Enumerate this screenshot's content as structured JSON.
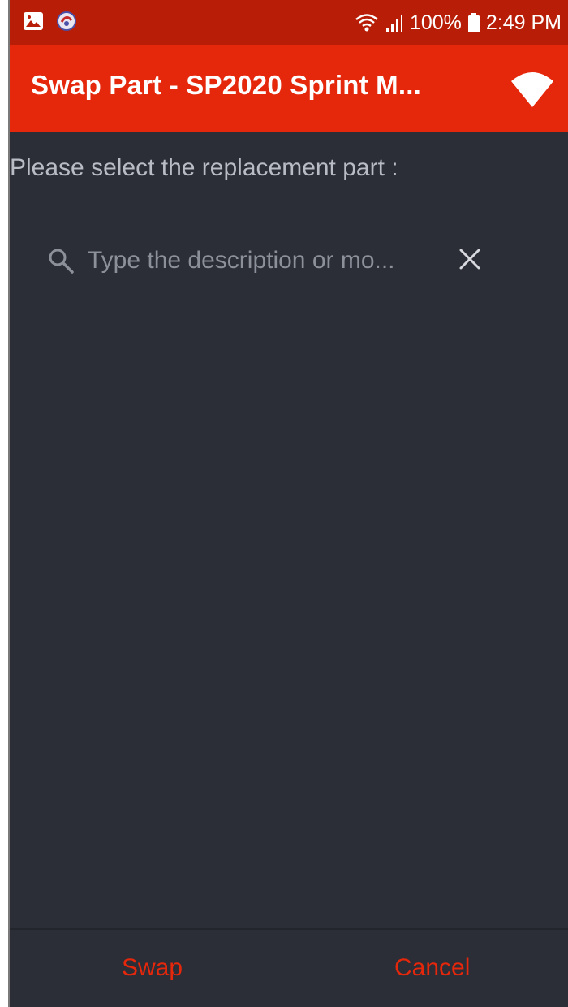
{
  "status_bar": {
    "battery": "100%",
    "time": "2:49 PM",
    "icons": [
      "gallery-icon",
      "app-notification-icon",
      "wifi-icon",
      "signal-icon",
      "battery-icon"
    ]
  },
  "app_bar": {
    "title": "Swap Part - SP2020 Sprint M...",
    "status_icon": "wifi-connected-icon"
  },
  "content": {
    "prompt": "Please select the replacement part :"
  },
  "search": {
    "placeholder": "Type the description or mo...",
    "value": ""
  },
  "actions": {
    "swap_label": "Swap",
    "cancel_label": "Cancel"
  },
  "colors": {
    "status_bar": "#b71d07",
    "app_bar": "#e5270b",
    "background": "#2b2d37",
    "accent_text": "#e5270b"
  }
}
